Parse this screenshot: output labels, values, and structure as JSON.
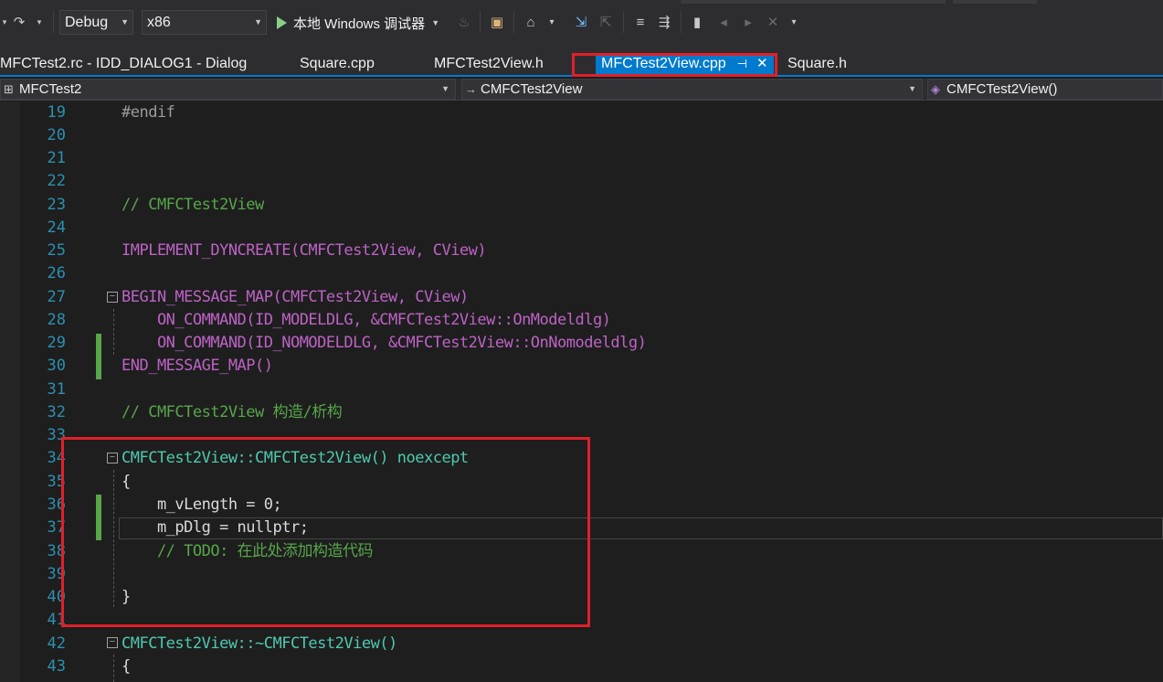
{
  "toolbar": {
    "config": "Debug",
    "platform": "x86",
    "start_label": "本地 Windows 调试器"
  },
  "tabs": [
    {
      "label": "MFCTest2.rc - IDD_DIALOG1 - Dialog"
    },
    {
      "label": "Square.cpp"
    },
    {
      "label": "MFCTest2View.h"
    },
    {
      "label": "MFCTest2View.cpp",
      "active": true
    },
    {
      "label": "Square.h"
    }
  ],
  "nav": {
    "project": "MFCTest2",
    "scope": "CMFCTest2View",
    "member": "CMFCTest2View()"
  },
  "editor": {
    "lines": [
      {
        "n": "19",
        "code": "#endif"
      },
      {
        "n": "20",
        "code": ""
      },
      {
        "n": "21",
        "code": ""
      },
      {
        "n": "22",
        "code": ""
      },
      {
        "n": "23",
        "code": "// CMFCTest2View"
      },
      {
        "n": "24",
        "code": ""
      },
      {
        "n": "25",
        "code": "IMPLEMENT_DYNCREATE(CMFCTest2View, CView)"
      },
      {
        "n": "26",
        "code": ""
      },
      {
        "n": "27",
        "code": "BEGIN_MESSAGE_MAP(CMFCTest2View, CView)"
      },
      {
        "n": "28",
        "code": "    ON_COMMAND(ID_MODELDLG, &CMFCTest2View::OnModeldlg)"
      },
      {
        "n": "29",
        "code": "    ON_COMMAND(ID_NOMODELDLG, &CMFCTest2View::OnNomodeldlg)"
      },
      {
        "n": "30",
        "code": "END_MESSAGE_MAP()"
      },
      {
        "n": "31",
        "code": ""
      },
      {
        "n": "32",
        "code": "// CMFCTest2View 构造/析构"
      },
      {
        "n": "33",
        "code": ""
      },
      {
        "n": "34",
        "code": "CMFCTest2View::CMFCTest2View() noexcept"
      },
      {
        "n": "35",
        "code": "{"
      },
      {
        "n": "36",
        "code": "    m_vLength = 0;"
      },
      {
        "n": "37",
        "code": "    m_pDlg = nullptr;"
      },
      {
        "n": "38",
        "code": "    // TODO: 在此处添加构造代码"
      },
      {
        "n": "39",
        "code": ""
      },
      {
        "n": "40",
        "code": "}"
      },
      {
        "n": "41",
        "code": ""
      },
      {
        "n": "42",
        "code": "CMFCTest2View::~CMFCTest2View()"
      },
      {
        "n": "43",
        "code": "{"
      }
    ]
  },
  "colors": {
    "accent": "#007acc",
    "highlight_box": "#e0202a",
    "comment": "#57a64a",
    "keyword": "#569cd6",
    "type": "#4ec9b0",
    "macro": "#bd63c5",
    "line_number": "#2b91af"
  },
  "icons": [
    "redo-icon",
    "play-icon",
    "hot-reload-icon",
    "open-folder-icon",
    "browse-icon",
    "step-icon",
    "bookmark-icon",
    "comment-icon",
    "close-icon",
    "pin-icon"
  ]
}
